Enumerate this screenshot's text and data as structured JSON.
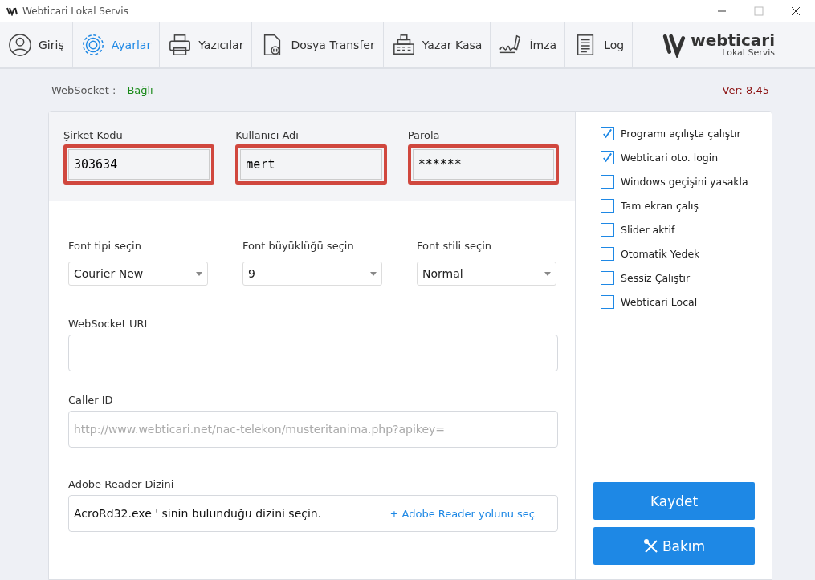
{
  "window": {
    "title": "Webticari Lokal Servis"
  },
  "nav": [
    {
      "label": "Giriş",
      "kind": "user",
      "selected": false
    },
    {
      "label": "Ayarlar",
      "kind": "gear",
      "selected": true
    },
    {
      "label": "Yazıcılar",
      "kind": "printer",
      "selected": false
    },
    {
      "label": "Dosya Transfer",
      "kind": "file",
      "selected": false
    },
    {
      "label": "Yazar Kasa",
      "kind": "register",
      "selected": false
    },
    {
      "label": "İmza",
      "kind": "signature",
      "selected": false
    },
    {
      "label": "Log",
      "kind": "document",
      "selected": false
    }
  ],
  "logo": {
    "name": "webticari",
    "subtitle": "Lokal Servis"
  },
  "status": {
    "label": "WebSocket :",
    "value": "Bağlı",
    "version": "Ver: 8.45"
  },
  "credentials": [
    {
      "label": "Şirket Kodu",
      "value": "303634",
      "highlighted": true
    },
    {
      "label": "Kullanıcı Adı",
      "value": "mert",
      "highlighted": true
    },
    {
      "label": "Parola",
      "value": "******",
      "highlighted": true
    }
  ],
  "fonts": [
    {
      "label": "Font tipi seçin",
      "value": "Courier New"
    },
    {
      "label": "Font büyüklüğü seçin",
      "value": "9"
    },
    {
      "label": "Font stili seçin",
      "value": "Normal"
    }
  ],
  "websocket_url": {
    "label": "WebSocket URL"
  },
  "caller_id": {
    "label": "Caller ID",
    "placeholder": "http://www.webticari.net/nac-telekon/musteritanima.php?apikey="
  },
  "adobe": {
    "label": "Adobe Reader Dizini",
    "text": "AcroRd32.exe ' sinin bulunduğu dizini seçin.",
    "link": "+ Adobe Reader yolunu seç"
  },
  "options": [
    {
      "label": "Programı açılışta çalıştır",
      "checked": true
    },
    {
      "label": "Webticari oto. login",
      "checked": true
    },
    {
      "label": "Windows geçişini yasakla",
      "checked": false
    },
    {
      "label": "Tam ekran çalış",
      "checked": false
    },
    {
      "label": "Slider aktif",
      "checked": false
    },
    {
      "label": "Otomatik Yedek",
      "checked": false
    },
    {
      "label": "Sessiz Çalıştır",
      "checked": false
    },
    {
      "label": "Webticari Local",
      "checked": false
    }
  ],
  "buttons": [
    {
      "label": "Kaydet",
      "kind": "plain"
    },
    {
      "label": "Bakım",
      "kind": "tools"
    }
  ]
}
